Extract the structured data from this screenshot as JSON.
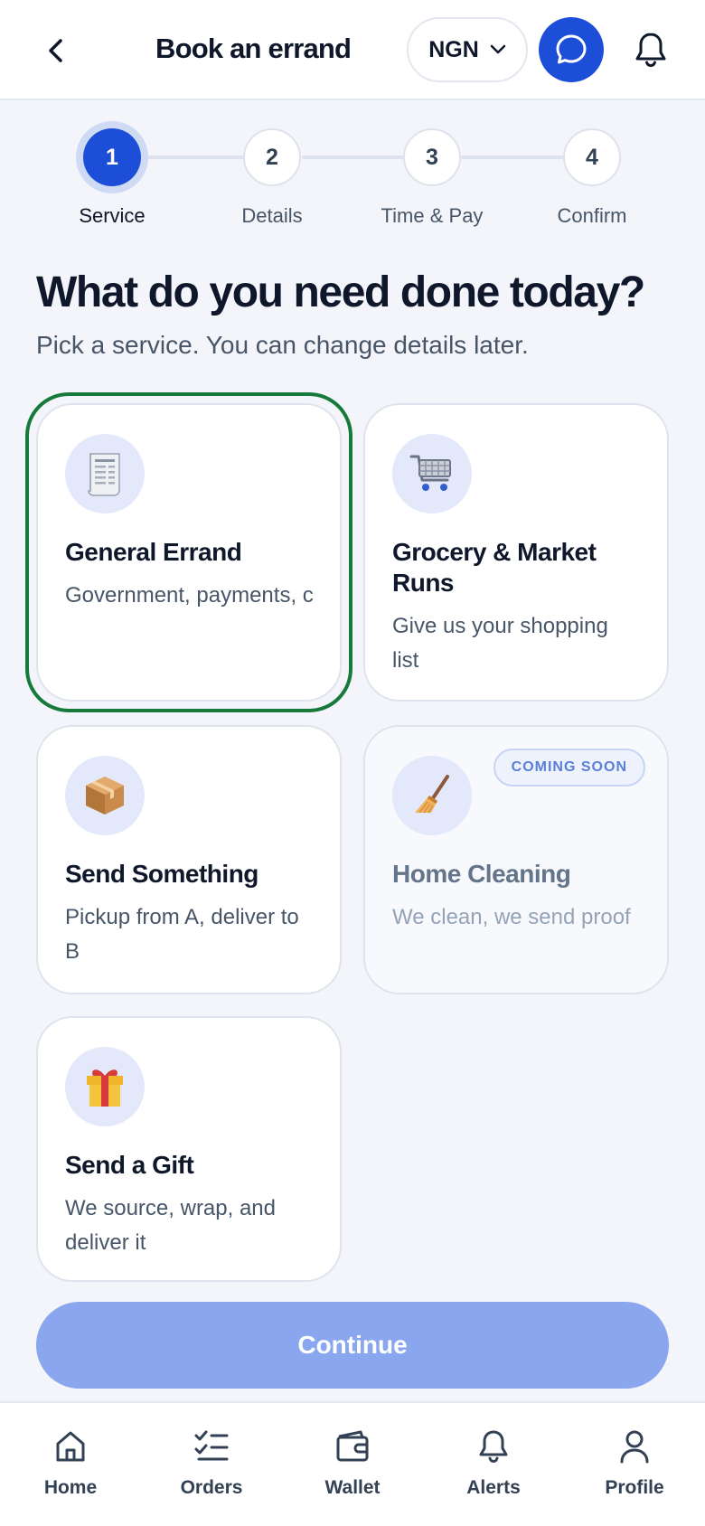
{
  "header": {
    "title": "Book an errand",
    "currency": "NGN",
    "back_icon": "chevron-left-icon",
    "chat_icon": "chat-bubble-icon",
    "bell_icon": "bell-icon"
  },
  "stepper": {
    "current": 1,
    "steps": [
      {
        "number": "1",
        "label": "Service"
      },
      {
        "number": "2",
        "label": "Details"
      },
      {
        "number": "3",
        "label": "Time & Pay"
      },
      {
        "number": "4",
        "label": "Confirm"
      }
    ]
  },
  "headline": "What do you need done today?",
  "subhead": "Pick a service. You can change details later.",
  "services": [
    {
      "title": "General Errand",
      "desc": "Government, payments, corporate ...",
      "icon": "receipt-icon",
      "selected": true
    },
    {
      "title": "Grocery & Market Runs",
      "desc": "Give us your shopping list",
      "icon": "shopping-cart-icon"
    },
    {
      "title": "Send Something",
      "desc": "Pickup from A, deliver to B",
      "icon": "package-icon"
    },
    {
      "title": "Home Cleaning",
      "desc": "We clean, we send proof",
      "icon": "broom-icon",
      "badge": "COMING SOON",
      "disabled": true
    },
    {
      "title": "Send a Gift",
      "desc": "We source, wrap, and deliver it",
      "icon": "gift-icon"
    }
  ],
  "continue_label": "Continue",
  "nav": [
    {
      "label": "Home",
      "icon": "home-icon"
    },
    {
      "label": "Orders",
      "icon": "checklist-icon"
    },
    {
      "label": "Wallet",
      "icon": "wallet-icon"
    },
    {
      "label": "Alerts",
      "icon": "bell-icon"
    },
    {
      "label": "Profile",
      "icon": "user-icon"
    }
  ],
  "colors": {
    "primary": "#1d4ed8",
    "selected_border": "#167a3a",
    "continue_disabled": "#8aa6ee",
    "background": "#f4f5fa"
  }
}
